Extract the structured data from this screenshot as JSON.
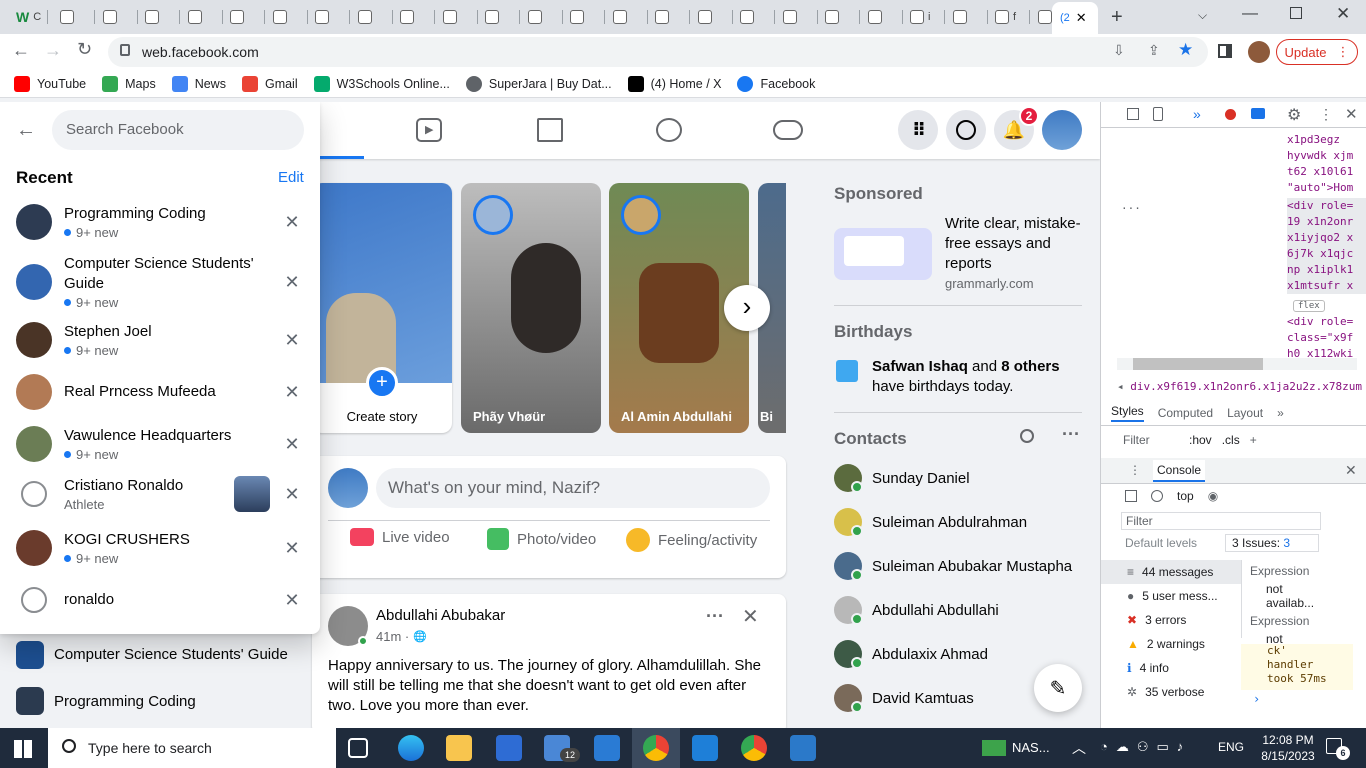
{
  "browser": {
    "tabs_first_label": "C",
    "tab_labels": [
      "",
      "",
      "",
      "",
      "",
      "",
      "",
      "",
      "",
      "",
      "",
      "",
      "",
      "",
      "",
      "",
      "",
      "",
      "",
      "",
      "i",
      "",
      "f",
      "f"
    ],
    "active_tab_label": "(2",
    "url": "web.facebook.com",
    "update_label": "Update",
    "bookmarks": [
      {
        "label": "YouTube",
        "icon": "youtube-icon"
      },
      {
        "label": "Maps",
        "icon": "maps-icon"
      },
      {
        "label": "News",
        "icon": "news-icon"
      },
      {
        "label": "Gmail",
        "icon": "google-icon"
      },
      {
        "label": "W3Schools Online...",
        "icon": "w3schools-icon"
      },
      {
        "label": "SuperJara | Buy Dat...",
        "icon": "globe-icon"
      },
      {
        "label": "(4) Home / X",
        "icon": "x-icon"
      },
      {
        "label": "Facebook",
        "icon": "facebook-icon"
      }
    ]
  },
  "search": {
    "placeholder": "Search Facebook",
    "recent_title": "Recent",
    "edit_label": "Edit",
    "items": [
      {
        "name": "Programming Coding",
        "sub": "9+ new"
      },
      {
        "name": "Computer Science Students' Guide",
        "sub": "9+ new"
      },
      {
        "name": "Stephen Joel",
        "sub": "9+ new"
      },
      {
        "name": "Real Prncess Mufeeda",
        "sub": ""
      },
      {
        "name": "Vawulence Headquarters",
        "sub": "9+ new"
      },
      {
        "name": "Cristiano Ronaldo",
        "sub": "Athlete"
      },
      {
        "name": "KOGI CRUSHERS",
        "sub": "9+ new"
      },
      {
        "name": "ronaldo",
        "sub": ""
      }
    ]
  },
  "left_nav": [
    {
      "label": "Computer Science Students' Guide"
    },
    {
      "label": "Programming Coding"
    }
  ],
  "header": {
    "notification_count": "2"
  },
  "stories": [
    {
      "label": "Create story"
    },
    {
      "label": "Phãy Vhøür"
    },
    {
      "label": "Al Amin Abdullahi"
    },
    {
      "label": "Bi"
    }
  ],
  "composer": {
    "placeholder": "What's on your mind, Nazif?",
    "live": "Live video",
    "photo": "Photo/video",
    "feeling": "Feeling/activity"
  },
  "post": {
    "author": "Abdullahi Abubakar",
    "time": "41m ·",
    "text": "Happy anniversary to us. The journey of glory. Alhamdulillah. She will still be telling me that she doesn't want to get old even after two. Love you more than ever."
  },
  "sponsored": {
    "title": "Sponsored",
    "ad_text": "Write clear, mistake-free essays and reports",
    "ad_domain": "grammarly.com"
  },
  "birthdays": {
    "title": "Birthdays",
    "name": "Safwan Ishaq",
    "rest1": " and ",
    "others": "8 others",
    "rest2": "have birthdays today."
  },
  "contacts": {
    "title": "Contacts",
    "list": [
      "Sunday Daniel",
      "Suleiman Abdulrahman",
      "Suleiman Abubakar Mustapha",
      "Abdullahi Abdullahi",
      "Abdulaxix Ahmad",
      "David Kamtuas"
    ]
  },
  "devtools": {
    "code_lines": [
      "x1pd3egz",
      "hyvwdk xjm",
      "t62 x10l61",
      "\"auto\">Hom",
      "<div role=",
      "19 x1n2onr",
      "x1iyjqo2 x",
      "6j7k x1qjc",
      "np x1iplk1",
      "x1mtsufr x",
      "<div role=",
      "class=\"x9f",
      "h0 x112wki"
    ],
    "flex_badge": "flex",
    "breadcrumb": "div.x9f619.x1n2onr6.x1ja2u2z.x78zum",
    "tabs": [
      "Styles",
      "Computed",
      "Layout"
    ],
    "filter": "Filter",
    "hov": ":hov",
    "cls": ".cls",
    "console_tab": "Console",
    "context": "top",
    "console_filter": "Filter",
    "levels": "Default levels",
    "issues": "3 Issues:",
    "issues_count": "3",
    "messages": [
      "44 messages",
      "5 user mess...",
      "3 errors",
      "2 warnings",
      "4 info",
      "35 verbose"
    ],
    "expression_label": "Expression",
    "expression_value": "not availab...",
    "log_lines": [
      "ck'",
      "handler",
      "took 57ms"
    ]
  },
  "taskbar": {
    "search_placeholder": "Type here to search",
    "tray_app": "NAS...",
    "lang": "ENG",
    "time": "12:08 PM",
    "date": "8/15/2023",
    "notif_count": "6",
    "mail_badge": "12"
  },
  "colors": {
    "fb_blue": "#1877f2",
    "update_red": "#d93025",
    "taskbar": "#1f2b3c"
  }
}
